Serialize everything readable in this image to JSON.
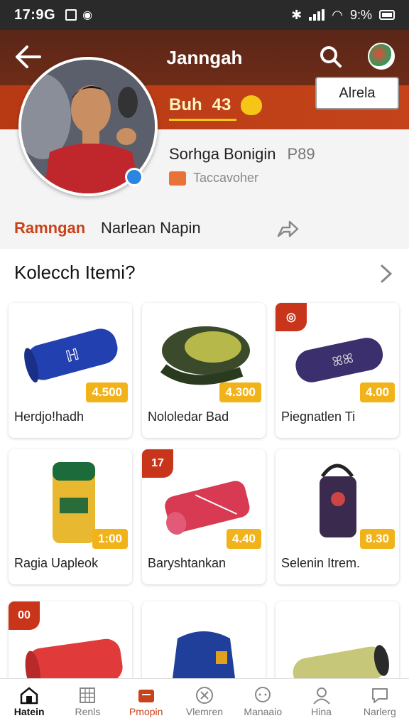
{
  "status_bar": {
    "time": "17:9G",
    "battery": "9:%"
  },
  "header": {
    "title": "Janngah",
    "back_icon": "arrow-left-icon",
    "search_icon": "search-icon",
    "avatar_icon": "avatar-icon"
  },
  "banner": {
    "coins": "Buh",
    "count": "43",
    "more": "•••"
  },
  "profile": {
    "name": "Sorhga Bonigin",
    "number": "P89",
    "meta": "Taccavoher",
    "tab_active": "Ramngan",
    "tab_other": "Narlean Napin",
    "follow_label": "Alrela"
  },
  "section": {
    "title": "Kolecch Itemi?"
  },
  "items": [
    {
      "name": "Herdjo!hadh",
      "price": "4.500",
      "badge": ""
    },
    {
      "name": "Nololedar Bad",
      "price": "4.300",
      "badge": ""
    },
    {
      "name": "Piegnatlen Ti",
      "price": "4.00",
      "badge": "◎"
    },
    {
      "name": "Ragia Uapleok",
      "price": "1:00",
      "badge": ""
    },
    {
      "name": "Baryshtankan",
      "price": "4.40",
      "badge": "17"
    },
    {
      "name": "Selenin Itrem.",
      "price": "8.30",
      "badge": ""
    },
    {
      "name": "",
      "price": "",
      "badge": "00"
    },
    {
      "name": "",
      "price": "",
      "badge": ""
    },
    {
      "name": "",
      "price": "",
      "badge": ""
    }
  ],
  "bottom_nav": [
    {
      "label": "Hatein",
      "icon": "home-icon"
    },
    {
      "label": "Renls",
      "icon": "grid-icon"
    },
    {
      "label": "Pmopin",
      "icon": "shop-icon"
    },
    {
      "label": "Vlemren",
      "icon": "compass-icon"
    },
    {
      "label": "Manaaio",
      "icon": "chat-icon"
    },
    {
      "label": "Hina",
      "icon": "user-icon"
    },
    {
      "label": "Narlerg",
      "icon": "message-icon"
    }
  ],
  "colors": {
    "accent": "#c9421a",
    "header": "#5a2618",
    "price": "#f2b31a"
  }
}
